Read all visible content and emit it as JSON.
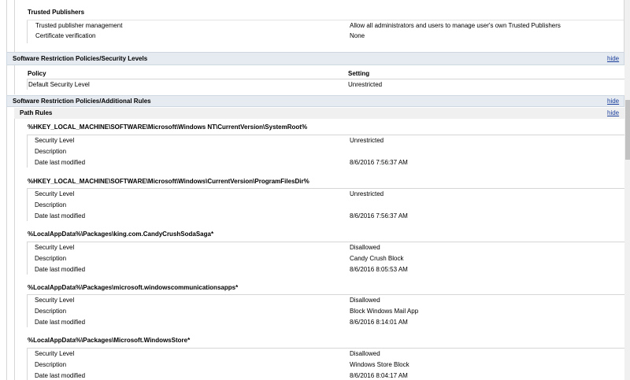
{
  "trusted_publishers": {
    "title": "Trusted Publishers",
    "rows": [
      {
        "label": "Trusted publisher management",
        "value": "Allow all administrators and users to manage user's own Trusted Publishers"
      },
      {
        "label": "Certificate verification",
        "value": "None"
      }
    ]
  },
  "security_levels": {
    "title": "Software Restriction Policies/Security Levels",
    "hide": "hide",
    "col_policy": "Policy",
    "col_setting": "Setting",
    "row_label": "Default Security Level",
    "row_value": "Unrestricted"
  },
  "additional_rules": {
    "title": "Software Restriction Policies/Additional Rules",
    "hide": "hide",
    "path_rules_title": "Path Rules",
    "path_rules_hide": "hide",
    "rules": [
      {
        "path": "%HKEY_LOCAL_MACHINE\\SOFTWARE\\Microsoft\\Windows NT\\CurrentVersion\\SystemRoot%",
        "security_label": "Security Level",
        "security_value": "Unrestricted",
        "description_label": "Description",
        "description_value": "",
        "date_label": "Date last modified",
        "date_value": "8/6/2016 7:56:37 AM"
      },
      {
        "path": "%HKEY_LOCAL_MACHINE\\SOFTWARE\\Microsoft\\Windows\\CurrentVersion\\ProgramFilesDir%",
        "security_label": "Security Level",
        "security_value": "Unrestricted",
        "description_label": "Description",
        "description_value": "",
        "date_label": "Date last modified",
        "date_value": "8/6/2016 7:56:37 AM"
      },
      {
        "path": "%LocalAppData%\\Packages\\king.com.CandyCrushSodaSaga*",
        "security_label": "Security Level",
        "security_value": "Disallowed",
        "description_label": "Description",
        "description_value": "Candy Crush Block",
        "date_label": "Date last modified",
        "date_value": "8/6/2016 8:05:53 AM"
      },
      {
        "path": "%LocalAppData%\\Packages\\microsoft.windowscommunicationsapps*",
        "security_label": "Security Level",
        "security_value": "Disallowed",
        "description_label": "Description",
        "description_value": "Block Windows Mail App",
        "date_label": "Date last modified",
        "date_value": "8/6/2016 8:14:01 AM"
      },
      {
        "path": "%LocalAppData%\\Packages\\Microsoft.WindowsStore*",
        "security_label": "Security Level",
        "security_value": "Disallowed",
        "description_label": "Description",
        "description_value": "Windows Store Block",
        "date_label": "Date last modified",
        "date_value": "8/6/2016 8:04:17 AM"
      }
    ]
  }
}
